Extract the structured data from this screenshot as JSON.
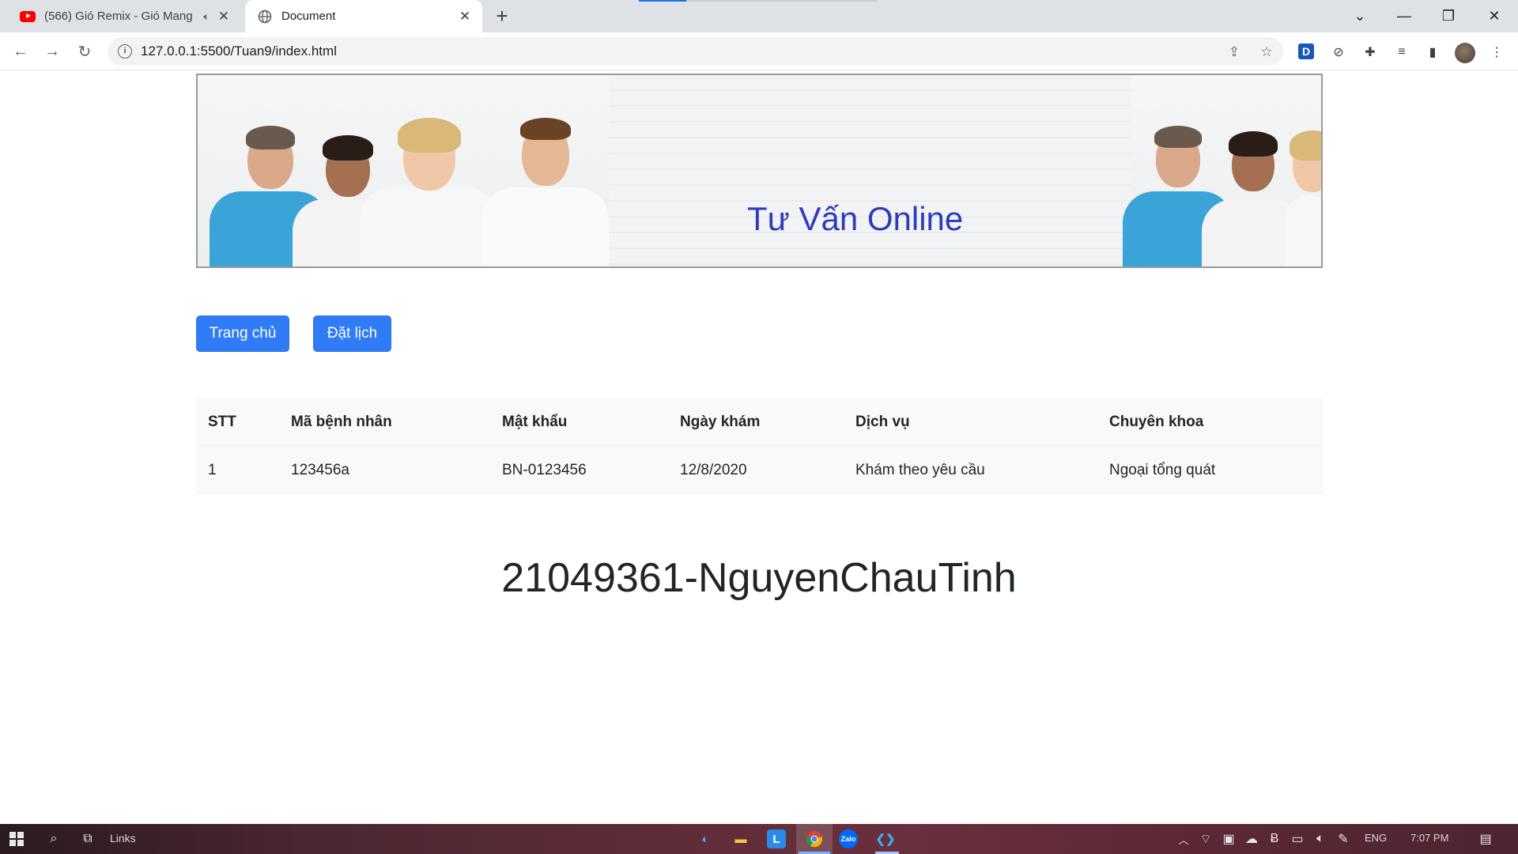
{
  "browser": {
    "tabs": [
      {
        "title": "(566) Gió Remix - Gió Mang",
        "active": false,
        "audio_icon": "speaker-icon"
      },
      {
        "title": "Document",
        "active": true
      }
    ],
    "url": "127.0.0.1:5500/Tuan9/index.html",
    "extension_d_label": "D"
  },
  "banner": {
    "title": "Tư Vấn Online"
  },
  "nav": {
    "home_label": "Trang chủ",
    "booking_label": "Đặt lịch"
  },
  "table": {
    "headers": [
      "STT",
      "Mã bệnh nhân",
      "Mật khẩu",
      "Ngày khám",
      "Dịch vụ",
      "Chuyên khoa"
    ],
    "rows": [
      [
        "1",
        "123456a",
        "BN-0123456",
        "12/8/2020",
        "Khám theo yêu cầu",
        "Ngoại tổng quát"
      ]
    ]
  },
  "footer_title": "21049361-NguyenChauTinh",
  "taskbar": {
    "search_hint": "Links",
    "language": "ENG",
    "time": "7:07 PM",
    "apps": [
      "edge-icon",
      "file-explorer-icon",
      "l-app-icon",
      "chrome-icon",
      "zalo-icon",
      "vscode-icon"
    ]
  },
  "colors": {
    "primary_button": "#2f7cf6",
    "banner_title": "#2d3cb8",
    "table_bg": "#f8f9fb"
  }
}
